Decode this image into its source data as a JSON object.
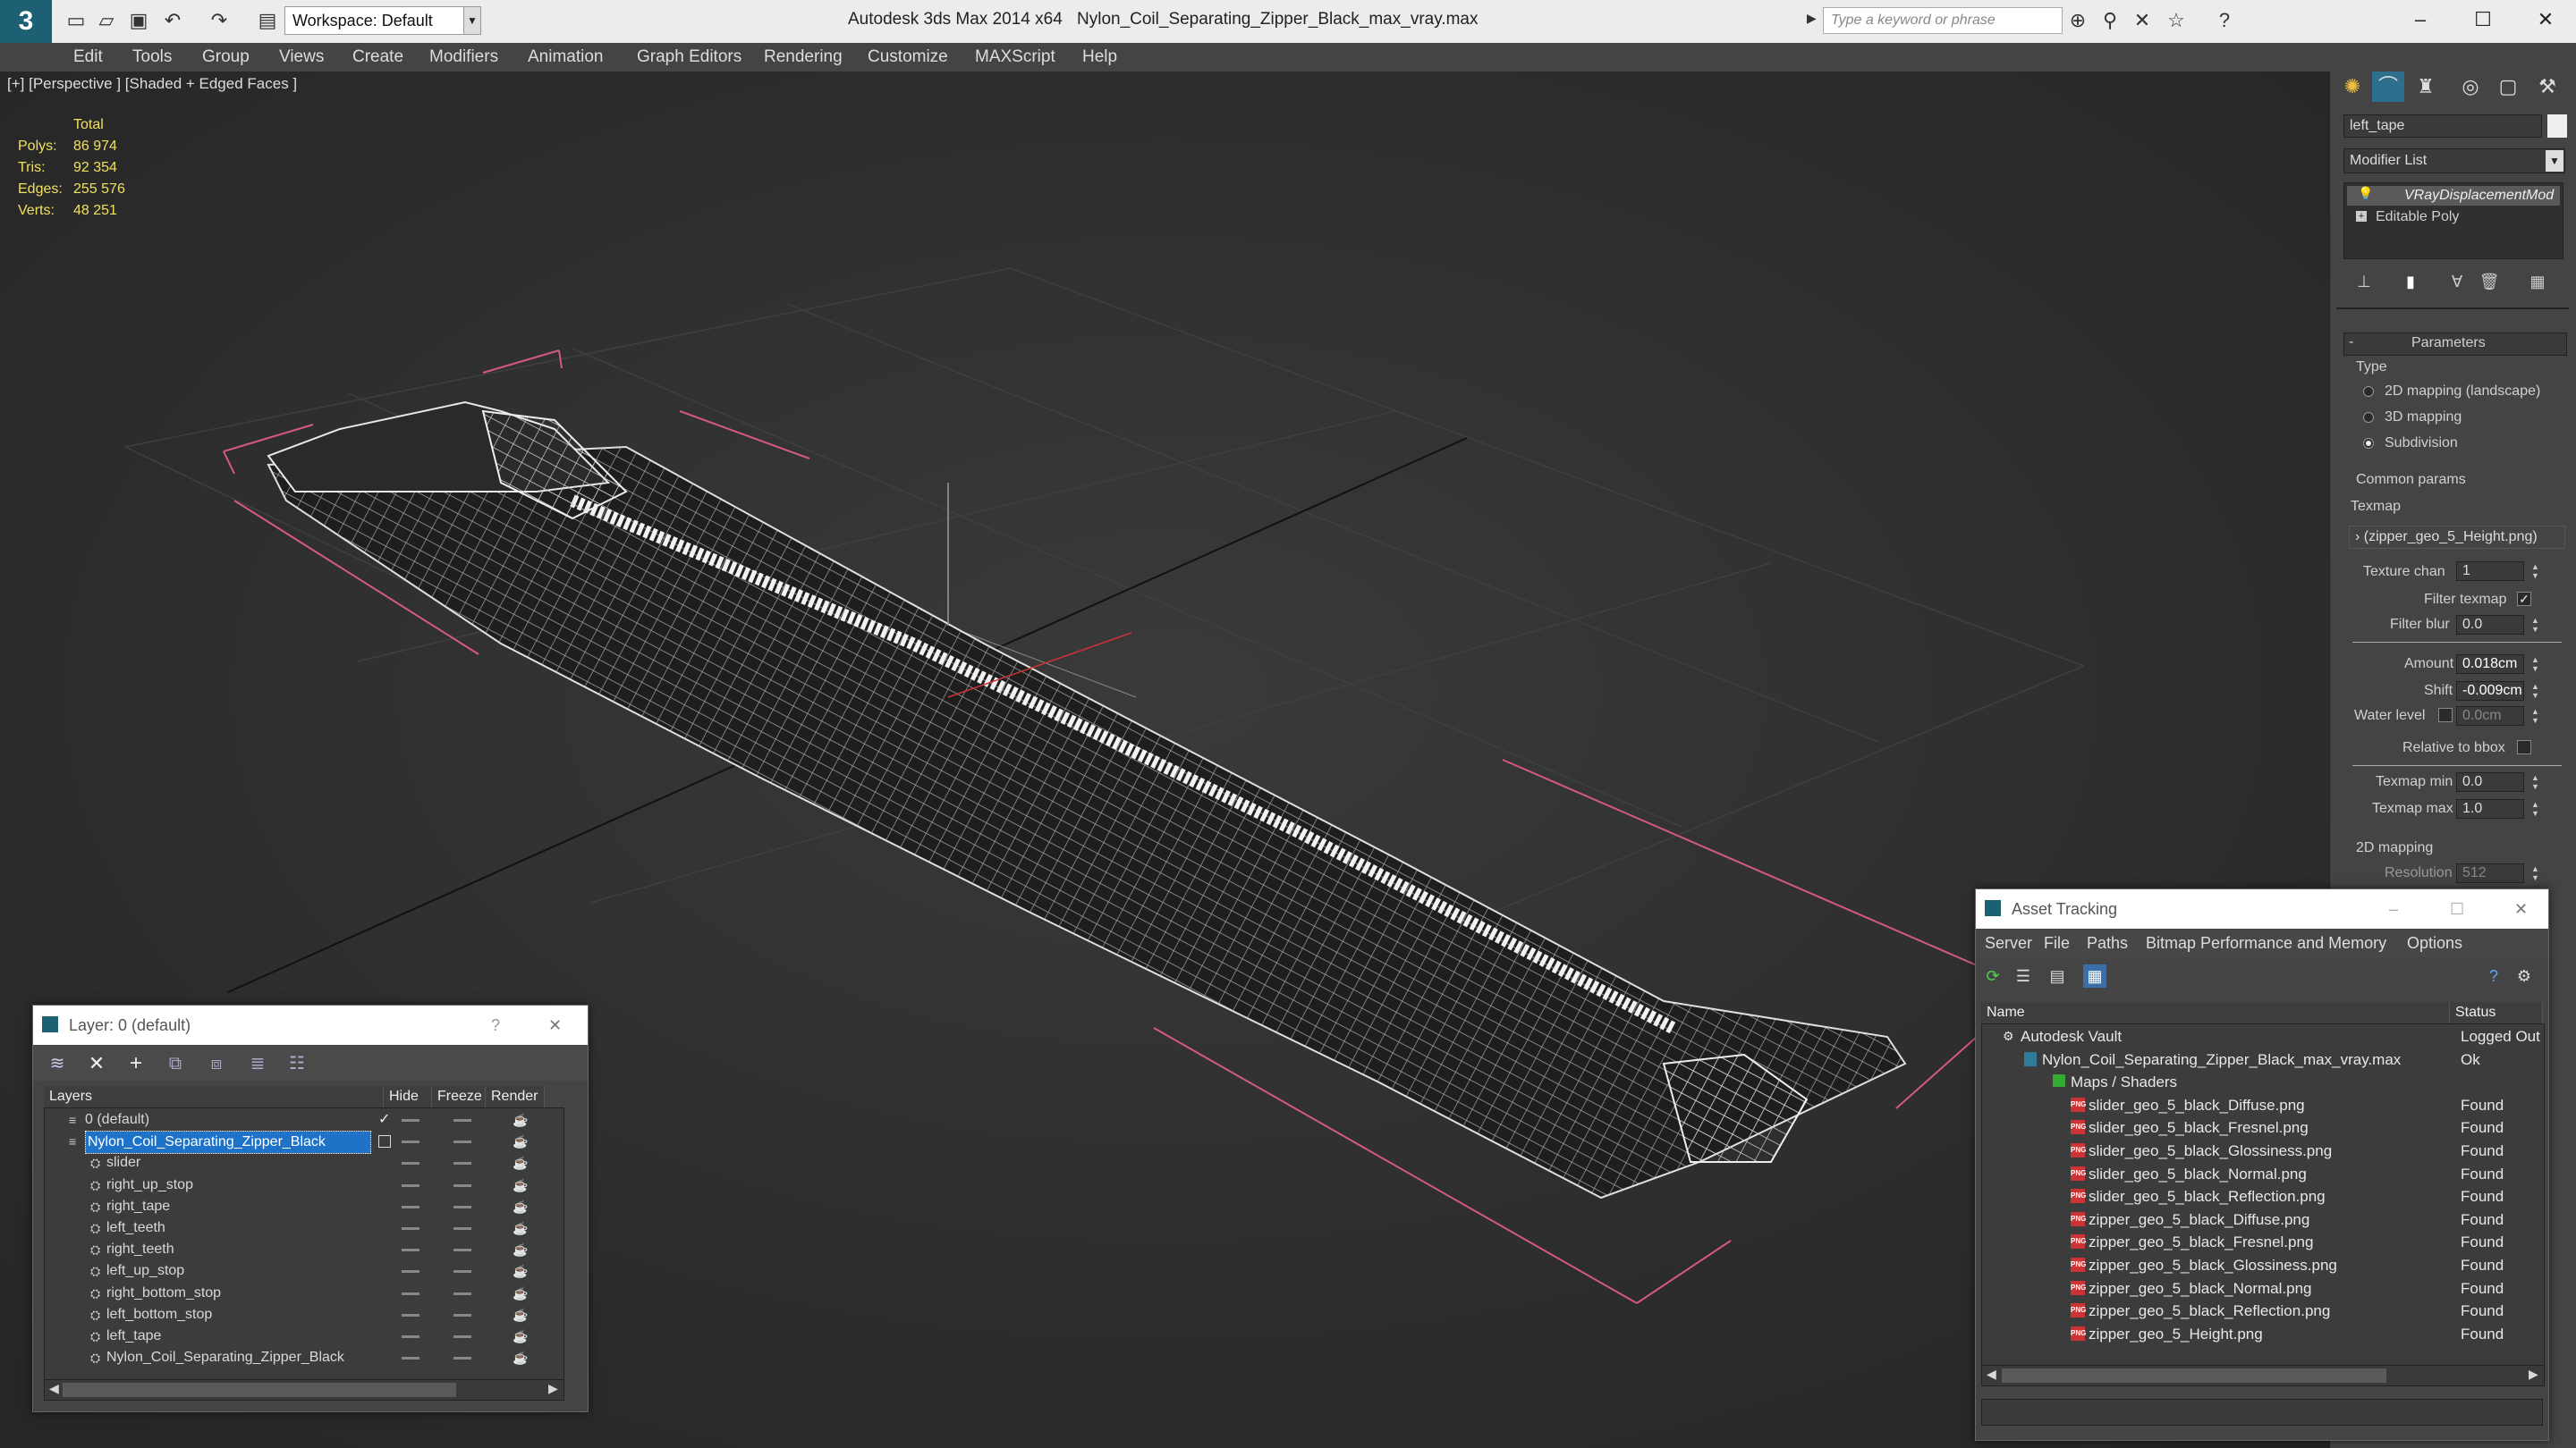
{
  "app": {
    "title": "Autodesk 3ds Max  2014 x64",
    "file": "Nylon_Coil_Separating_Zipper_Black_max_vray.max",
    "workspace": "Workspace: Default",
    "search_placeholder": "Type a keyword or phrase"
  },
  "menu": [
    "Edit",
    "Tools",
    "Group",
    "Views",
    "Create",
    "Modifiers",
    "Animation",
    "Graph Editors",
    "Rendering",
    "Customize",
    "MAXScript",
    "Help"
  ],
  "viewport": {
    "label": "[+] [Perspective ] [Shaded + Edged Faces ]",
    "stats": {
      "header": "Total",
      "rows": [
        {
          "label": "Polys:",
          "value": "86 974"
        },
        {
          "label": "Tris:",
          "value": "92 354"
        },
        {
          "label": "Edges:",
          "value": "255 576"
        },
        {
          "label": "Verts:",
          "value": "48 251"
        }
      ]
    }
  },
  "command_panel": {
    "object_name": "left_tape",
    "modifier_list": "Modifier List",
    "stack": [
      "VRayDisplacementMod",
      "Editable Poly"
    ],
    "rollout": "Parameters",
    "type_group": "Type",
    "type_options": [
      "2D mapping (landscape)",
      "3D mapping",
      "Subdivision"
    ],
    "common_group": "Common params",
    "texmap_label": "Texmap",
    "texmap_value": "› (zipper_geo_5_Height.png)",
    "texture_chan": {
      "label": "Texture chan",
      "value": "1"
    },
    "filter_texmap": "Filter texmap",
    "filter_blur": {
      "label": "Filter blur",
      "value": "0.0"
    },
    "amount": {
      "label": "Amount",
      "value": "0.018cm"
    },
    "shift": {
      "label": "Shift",
      "value": "-0.009cm"
    },
    "water_level": {
      "label": "Water level",
      "value": "0.0cm"
    },
    "relative_bbox": "Relative to bbox",
    "texmap_min": {
      "label": "Texmap min",
      "value": "0.0"
    },
    "texmap_max": {
      "label": "Texmap max",
      "value": "1.0"
    },
    "mapping2d_group": "2D mapping",
    "resolution": {
      "label": "Resolution",
      "value": "512"
    }
  },
  "layer_window": {
    "title": "Layer: 0 (default)",
    "help": "?",
    "close": "✕",
    "columns": [
      "Layers",
      "Hide",
      "Freeze",
      "Render"
    ],
    "rows": [
      {
        "name": "0 (default)",
        "indent": 0,
        "selected": false
      },
      {
        "name": "Nylon_Coil_Separating_Zipper_Black",
        "indent": 0,
        "selected": true
      },
      {
        "name": "slider",
        "indent": 1,
        "selected": false
      },
      {
        "name": "right_up_stop",
        "indent": 1,
        "selected": false
      },
      {
        "name": "right_tape",
        "indent": 1,
        "selected": false
      },
      {
        "name": "left_teeth",
        "indent": 1,
        "selected": false
      },
      {
        "name": "right_teeth",
        "indent": 1,
        "selected": false
      },
      {
        "name": "left_up_stop",
        "indent": 1,
        "selected": false
      },
      {
        "name": "right_bottom_stop",
        "indent": 1,
        "selected": false
      },
      {
        "name": "left_bottom_stop",
        "indent": 1,
        "selected": false
      },
      {
        "name": "left_tape",
        "indent": 1,
        "selected": false
      },
      {
        "name": "Nylon_Coil_Separating_Zipper_Black",
        "indent": 1,
        "selected": false
      }
    ]
  },
  "asset_window": {
    "title": "Asset Tracking",
    "menu": [
      "Server",
      "File",
      "Paths",
      "Bitmap Performance and Memory",
      "Options"
    ],
    "columns": [
      "Name",
      "Status"
    ],
    "rows": [
      {
        "name": "Autodesk Vault",
        "status": "Logged Out",
        "level": 0
      },
      {
        "name": "Nylon_Coil_Separating_Zipper_Black_max_vray.max",
        "status": "Ok",
        "level": 1
      },
      {
        "name": "Maps / Shaders",
        "status": "",
        "level": 2
      },
      {
        "name": "slider_geo_5_black_Diffuse.png",
        "status": "Found",
        "level": 3
      },
      {
        "name": "slider_geo_5_black_Fresnel.png",
        "status": "Found",
        "level": 3
      },
      {
        "name": "slider_geo_5_black_Glossiness.png",
        "status": "Found",
        "level": 3
      },
      {
        "name": "slider_geo_5_black_Normal.png",
        "status": "Found",
        "level": 3
      },
      {
        "name": "slider_geo_5_black_Reflection.png",
        "status": "Found",
        "level": 3
      },
      {
        "name": "zipper_geo_5_black_Diffuse.png",
        "status": "Found",
        "level": 3
      },
      {
        "name": "zipper_geo_5_black_Fresnel.png",
        "status": "Found",
        "level": 3
      },
      {
        "name": "zipper_geo_5_black_Glossiness.png",
        "status": "Found",
        "level": 3
      },
      {
        "name": "zipper_geo_5_black_Normal.png",
        "status": "Found",
        "level": 3
      },
      {
        "name": "zipper_geo_5_black_Reflection.png",
        "status": "Found",
        "level": 3
      },
      {
        "name": "zipper_geo_5_Height.png",
        "status": "Found",
        "level": 3
      }
    ]
  }
}
